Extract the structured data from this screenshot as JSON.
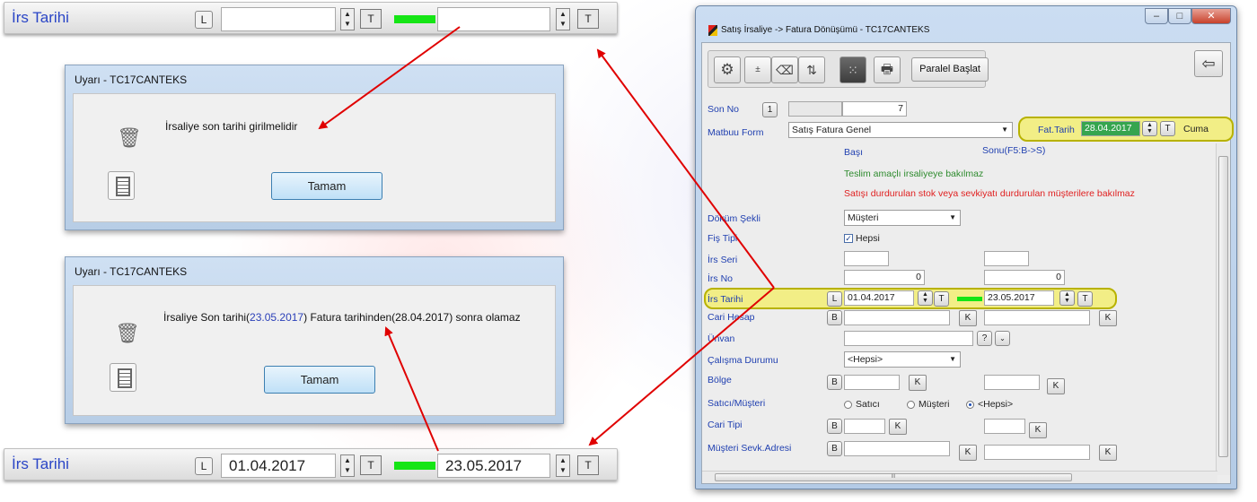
{
  "top_bar": {
    "label": "İrs Tarihi",
    "l_button": "L",
    "start_value": "",
    "t_button": "T",
    "end_value": ""
  },
  "dialog1": {
    "title": "Uyarı - TC17CANTEKS",
    "message": "İrsaliye son tarihi girilmelidir",
    "ok_label": "Tamam"
  },
  "dialog2": {
    "title": "Uyarı - TC17CANTEKS",
    "message_pre": "İrsaliye Son tarihi(",
    "message_date1": "23.05.2017",
    "message_mid": ") Fatura tarihinden(28.04.2017) sonra olamaz",
    "ok_label": "Tamam"
  },
  "bottom_bar": {
    "label": "İrs Tarihi",
    "l_button": "L",
    "start_value": "01.04.2017",
    "t_button": "T",
    "end_value": "23.05.2017"
  },
  "window": {
    "title": "Satış İrsaliye -> Fatura Dönüşümü - TC17CANTEKS",
    "paralel_label": "Paralel Başlat",
    "son_no_label": "Son No",
    "son_no_btn": "1",
    "son_no_value": "7",
    "matbuu_label": "Matbuu Form",
    "matbuu_value": "Satış Fatura Genel",
    "fat_tarih_label": "Fat.Tarih",
    "fat_tarih_value": "28.04.2017",
    "fat_t_button": "T",
    "fat_day": "Cuma",
    "basi_label": "Başı",
    "sonu_label": "Sonu(F5:B->S)",
    "info_green": "Teslim amaçlı irsaliyeye bakılmaz",
    "info_red": "Satışı durdurulan stok veya sevkiyatı durdurulan müşterilere bakılmaz",
    "dokum_label": "Döküm Şekli",
    "dokum_value": "Müşteri",
    "fis_tipi_label": "Fiş Tipi",
    "fis_tipi_check": "Hepsi",
    "irs_seri_label": "İrs Seri",
    "irs_no_label": "İrs No",
    "irs_no_start": "0",
    "irs_no_end": "0",
    "irs_tarihi_label": "İrs Tarihi",
    "irs_l_button": "L",
    "irs_tarihi_start": "01.04.2017",
    "irs_t_button": "T",
    "irs_tarihi_end": "23.05.2017",
    "cari_hesap_label": "Cari Hesap",
    "b_button": "B",
    "k_button": "K",
    "unvan_label": "Ünvan",
    "question_button": "?",
    "calisma_label": "Çalışma Durumu",
    "calisma_value": "<Hepsi>",
    "bolge_label": "Bölge",
    "satici_label": "Satıcı/Müşteri",
    "radio_satici": "Satıcı",
    "radio_musteri": "Müşteri",
    "radio_hepsi": "<Hepsi>",
    "cari_tipi_label": "Cari Tipi",
    "sevk_label": "Müşteri Sevk.Adresi",
    "scroll_mark": "III"
  },
  "colors": {
    "accent_blue": "#2a45c6",
    "highlight_yellow": "#f2ee86",
    "green_field": "#15e515",
    "info_green": "#2e8b2e",
    "info_red": "#e02020",
    "arrow_red": "#e00000"
  }
}
